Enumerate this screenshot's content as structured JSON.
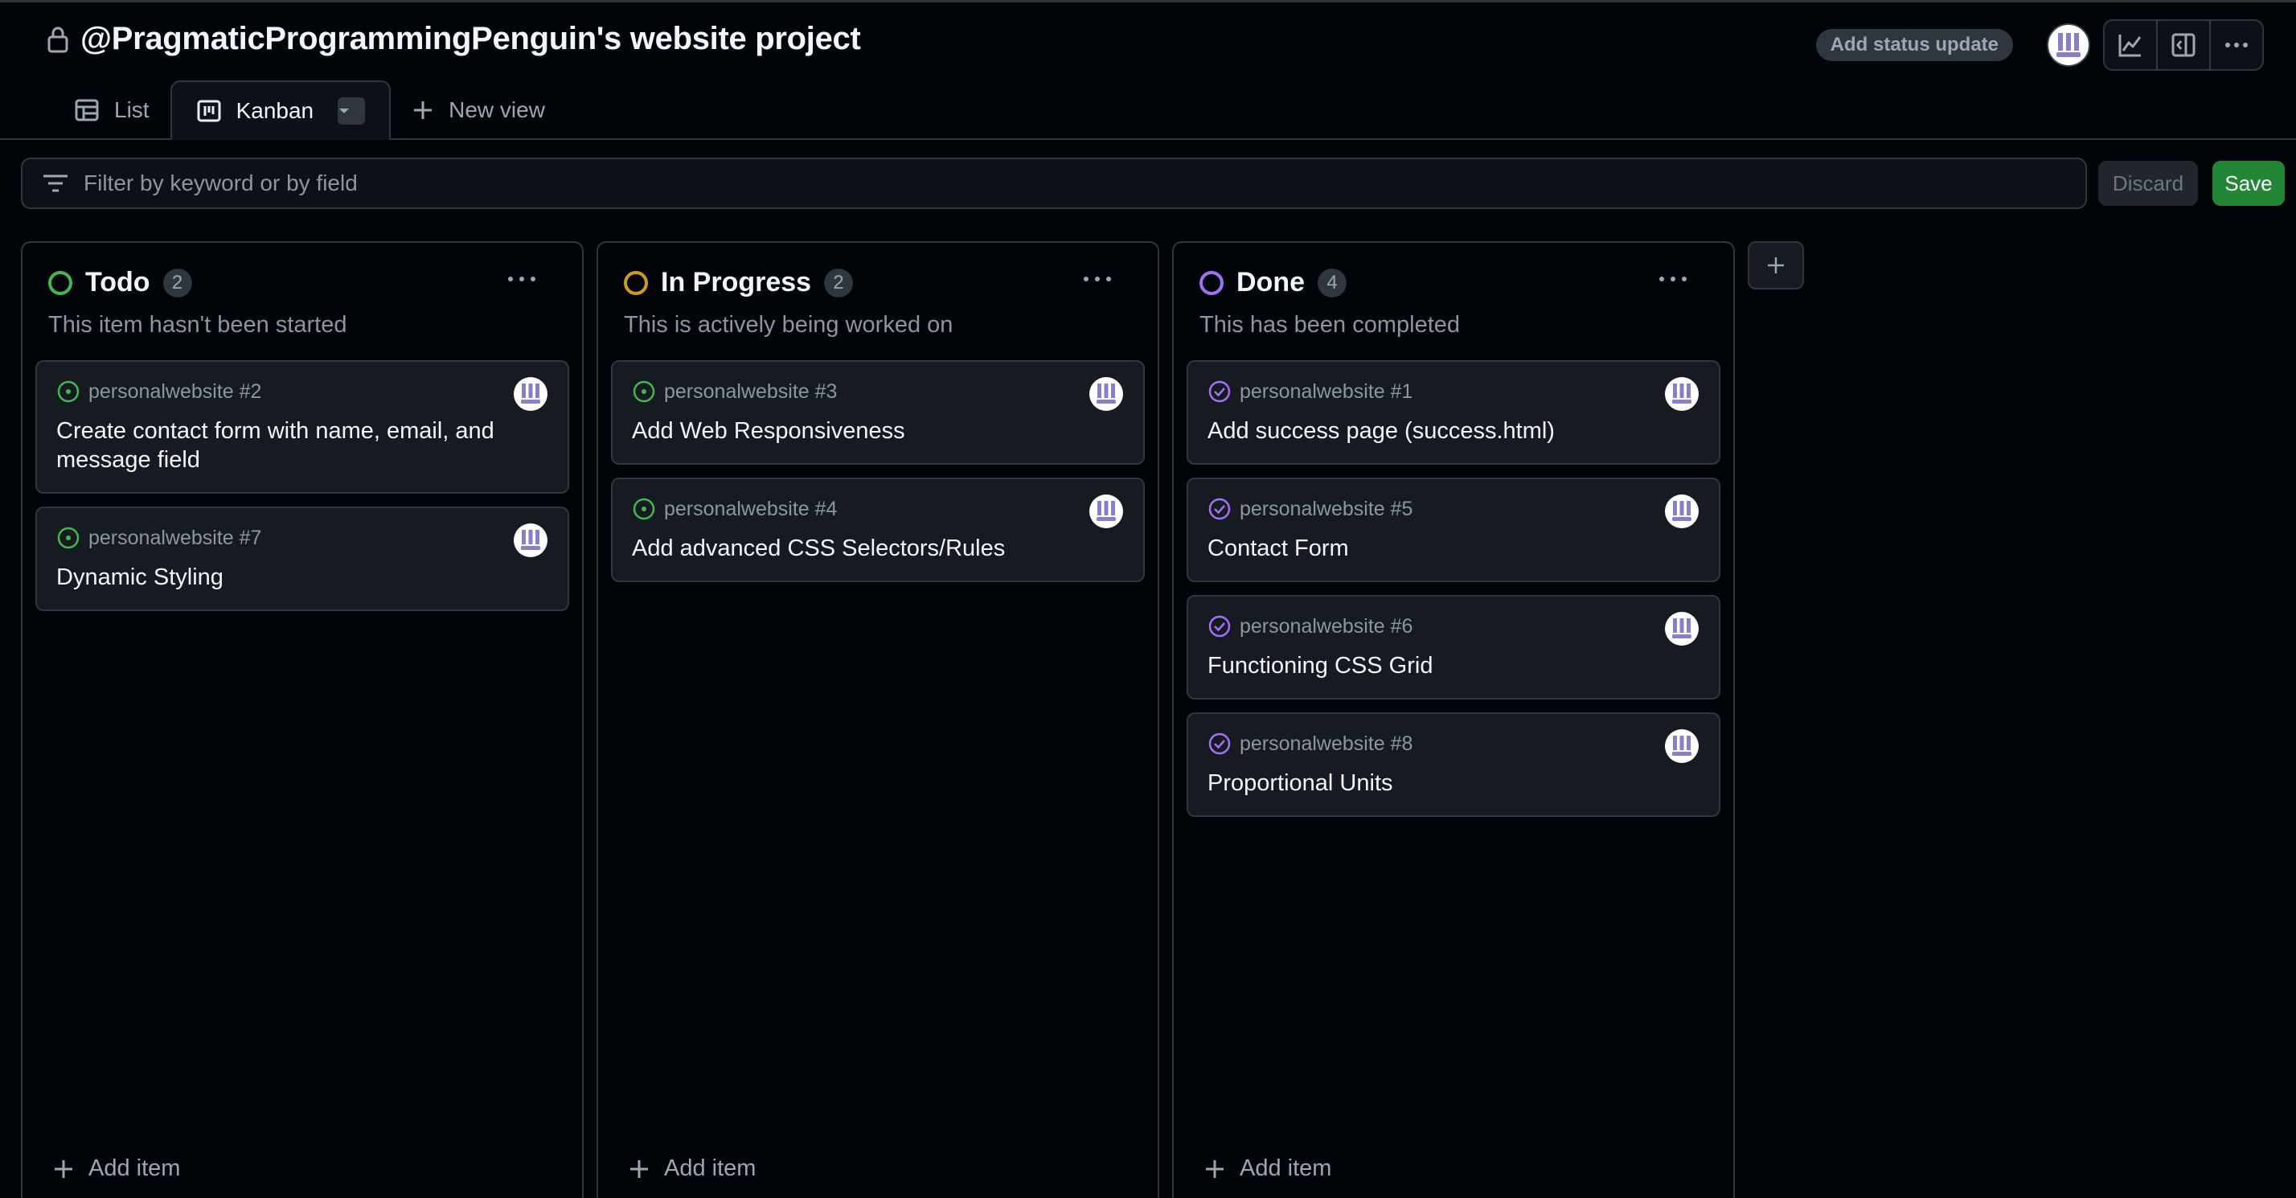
{
  "project": {
    "title": "@PragmaticProgrammingPenguin's website project",
    "status_button": "Add status update"
  },
  "header_icons": [
    "insights-icon",
    "side-panel-icon",
    "more-options-icon"
  ],
  "tabs": [
    {
      "label": "List",
      "icon": "table-icon",
      "active": false
    },
    {
      "label": "Kanban",
      "icon": "board-icon",
      "active": true
    },
    {
      "label": "New view",
      "icon": "plus-icon",
      "active": false
    }
  ],
  "filter": {
    "placeholder": "Filter by keyword or by field",
    "value": ""
  },
  "actions": {
    "discard": "Discard",
    "save": "Save"
  },
  "colors": {
    "todo": "#3fb950",
    "in_progress": "#d29922",
    "done": "#a371f7",
    "save_button": "#238636",
    "background": "#010409",
    "card": "#161b22"
  },
  "columns": [
    {
      "name": "Todo",
      "count": "2",
      "description": "This item hasn't been started",
      "add_item": "Add item",
      "cards": [
        {
          "ref": "personalwebsite #2",
          "title": "Create contact form with name, email, and message field",
          "state": "open"
        },
        {
          "ref": "personalwebsite #7",
          "title": "Dynamic Styling",
          "state": "open"
        }
      ]
    },
    {
      "name": "In Progress",
      "count": "2",
      "description": "This is actively being worked on",
      "add_item": "Add item",
      "cards": [
        {
          "ref": "personalwebsite #3",
          "title": "Add Web Responsiveness",
          "state": "open"
        },
        {
          "ref": "personalwebsite #4",
          "title": "Add advanced CSS Selectors/Rules",
          "state": "open"
        }
      ]
    },
    {
      "name": "Done",
      "count": "4",
      "description": "This has been completed",
      "add_item": "Add item",
      "cards": [
        {
          "ref": "personalwebsite #1",
          "title": "Add success page (success.html)",
          "state": "closed"
        },
        {
          "ref": "personalwebsite #5",
          "title": "Contact Form",
          "state": "closed"
        },
        {
          "ref": "personalwebsite #6",
          "title": "Functioning CSS Grid",
          "state": "closed"
        },
        {
          "ref": "personalwebsite #8",
          "title": "Proportional Units",
          "state": "closed"
        }
      ]
    }
  ]
}
